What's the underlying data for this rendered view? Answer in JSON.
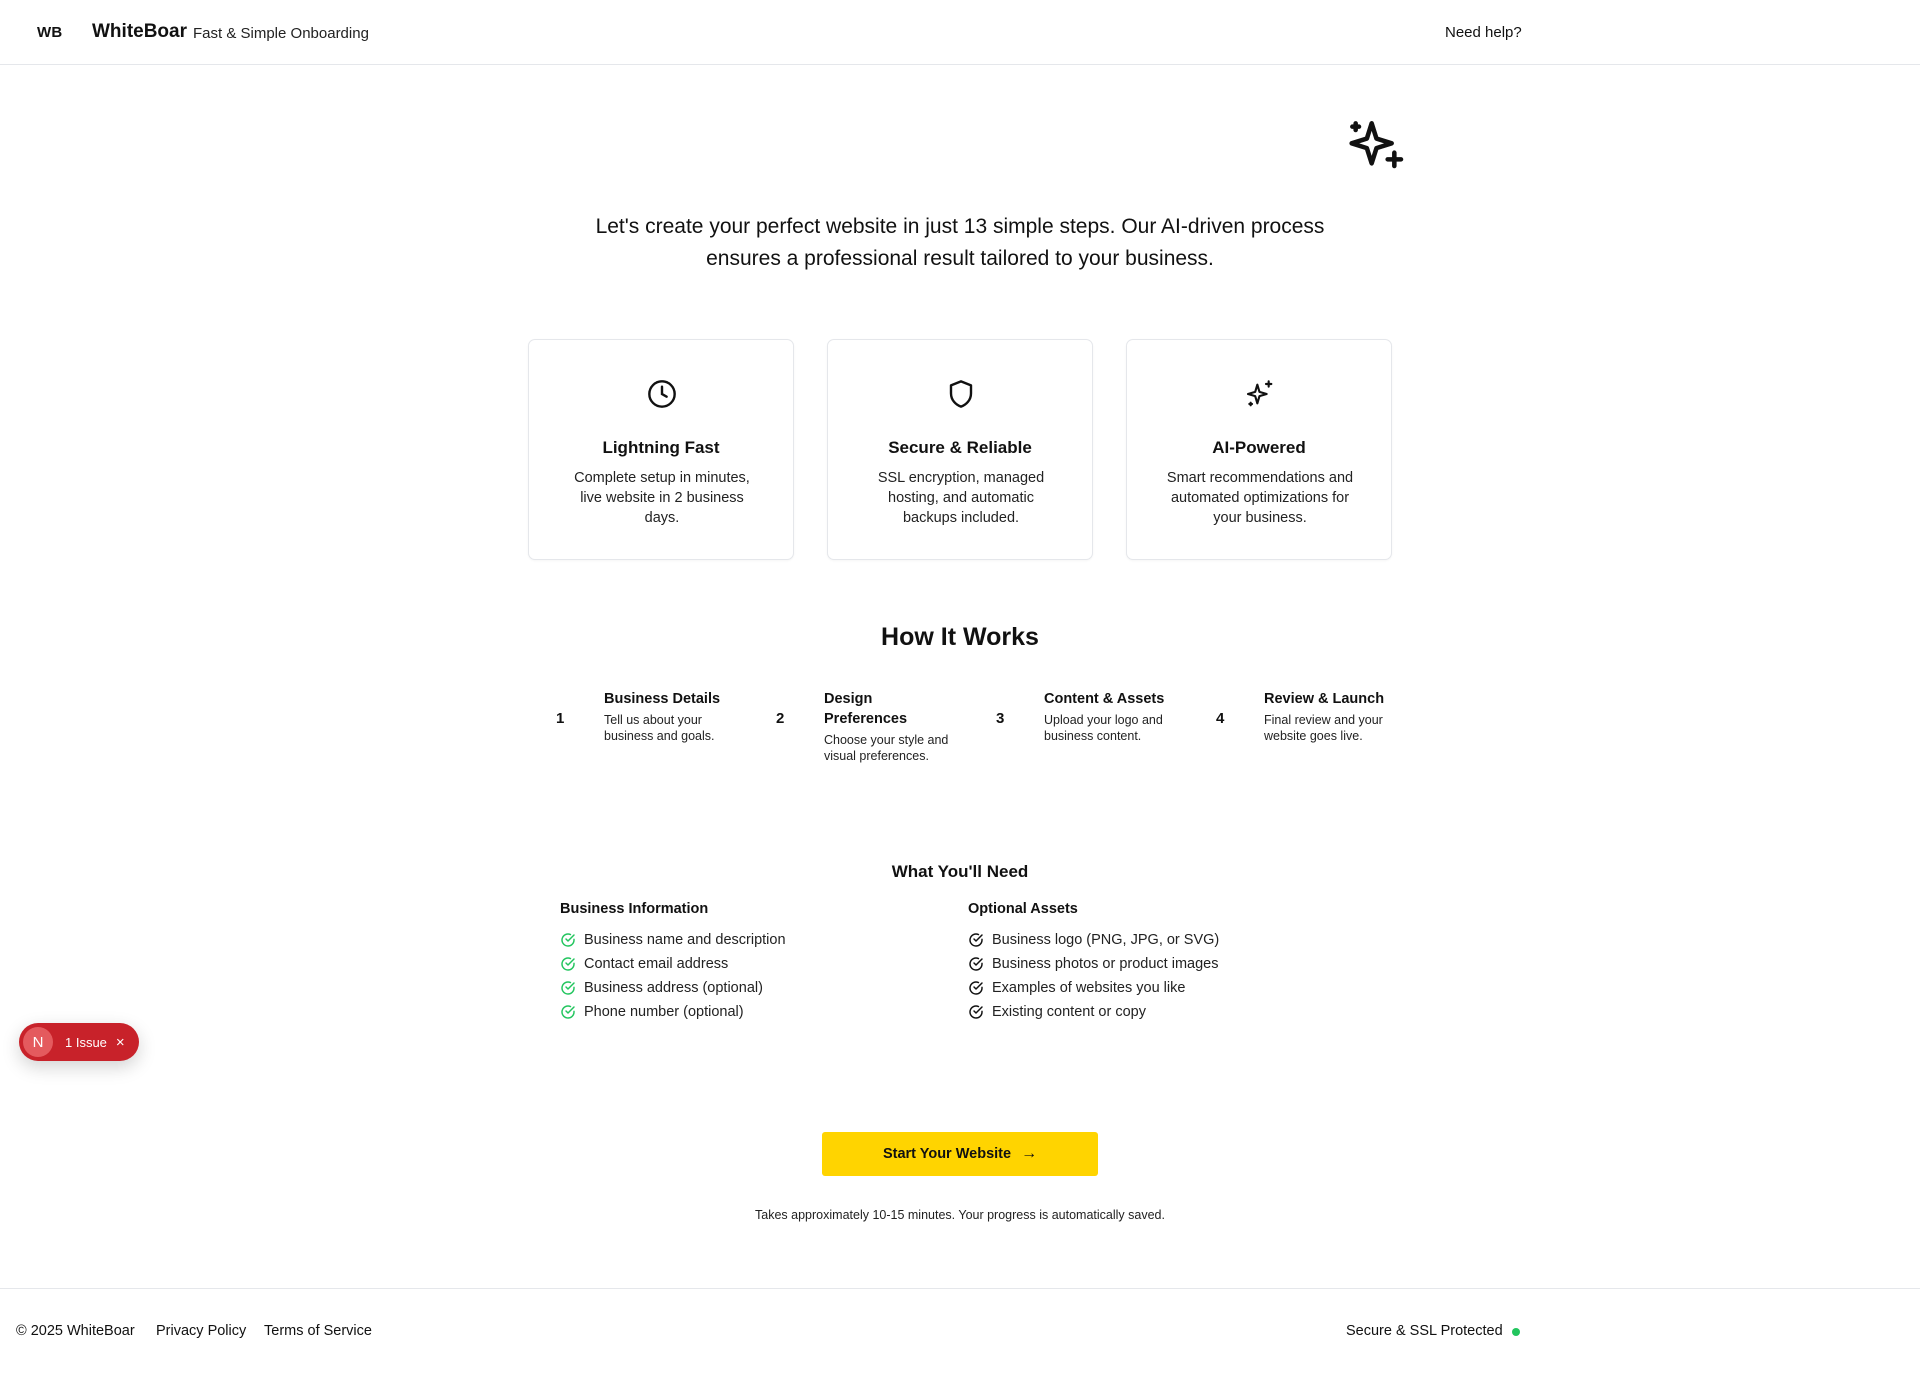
{
  "header": {
    "logo_mark": "WB",
    "brand": "WhiteBoar",
    "tagline": "Fast & Simple Onboarding",
    "help": "Need help?"
  },
  "hero": {
    "icon": "sparkles-icon",
    "intro": "Let's create your perfect website in just 13 simple steps. Our AI-driven process ensures a professional result tailored to your business."
  },
  "features": [
    {
      "icon": "clock-icon",
      "title": "Lightning Fast",
      "desc": "Complete setup in minutes, live website in 2 business days."
    },
    {
      "icon": "shield-icon",
      "title": "Secure & Reliable",
      "desc": "SSL encryption, managed hosting, and automatic backups included."
    },
    {
      "icon": "sparkles-icon",
      "title": "AI-Powered",
      "desc": "Smart recommendations and automated optimizations for your business."
    }
  ],
  "how": {
    "title": "How It Works",
    "steps": [
      {
        "num": "1",
        "title": "Business Details",
        "desc": "Tell us about your business and goals."
      },
      {
        "num": "2",
        "title": "Design Preferences",
        "desc": "Choose your style and visual preferences."
      },
      {
        "num": "3",
        "title": "Content & Assets",
        "desc": "Upload your logo and business content."
      },
      {
        "num": "4",
        "title": "Review & Launch",
        "desc": "Final review and your website goes live."
      }
    ]
  },
  "need": {
    "title": "What You'll Need",
    "business": {
      "title": "Business Information",
      "items": [
        "Business name and description",
        "Contact email address",
        "Business address (optional)",
        "Phone number (optional)"
      ]
    },
    "optional": {
      "title": "Optional Assets",
      "items": [
        "Business logo (PNG, JPG, or SVG)",
        "Business photos or product images",
        "Examples of websites you like",
        "Existing content or copy"
      ]
    }
  },
  "issue_badge": {
    "letter": "N",
    "text": "1 Issue",
    "close": "×"
  },
  "cta": {
    "label": "Start Your Website",
    "arrow": "→",
    "note": "Takes approximately 10-15 minutes. Your progress is automatically saved."
  },
  "footer": {
    "copyright": "© 2025 WhiteBoar",
    "privacy": "Privacy Policy",
    "terms": "Terms of Service",
    "secure": "Secure & SSL Protected"
  },
  "colors": {
    "accent": "#ffd400",
    "success": "#22c55e",
    "issue": "#c8222a",
    "border": "#e5e7eb"
  }
}
